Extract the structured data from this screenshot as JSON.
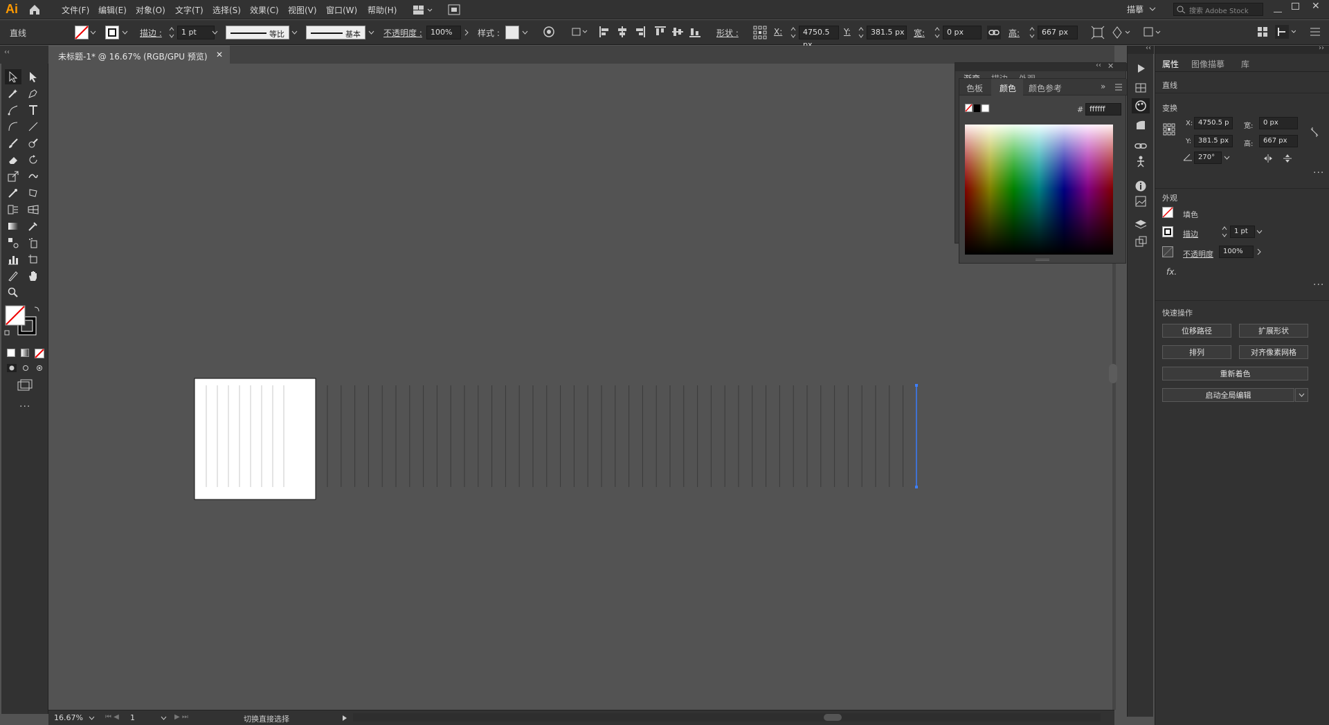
{
  "app": {
    "logo": "Ai"
  },
  "menu": [
    "文件(F)",
    "编辑(E)",
    "对象(O)",
    "文字(T)",
    "选择(S)",
    "效果(C)",
    "视图(V)",
    "窗口(W)",
    "帮助(H)"
  ],
  "topright": {
    "workspace": "描摹",
    "search_placeholder": "搜索 Adobe Stock"
  },
  "control": {
    "selection_label": "直线",
    "stroke_label": "描边 :",
    "stroke_value": "1 pt",
    "profile1": "等比",
    "profile2": "基本",
    "opacity_label": "不透明度 :",
    "opacity_value": "100%",
    "style_label": "样式 :",
    "shape_label": "形状 :",
    "x_label": "X:",
    "x_value": "4750.5 px",
    "y_label": "Y:",
    "y_value": "381.5 px",
    "w_label": "宽:",
    "w_value": "0 px",
    "h_label": "高:",
    "h_value": "667 px"
  },
  "doc_tab": {
    "title": "未标题-1* @ 16.67% (RGB/GPU 预览)"
  },
  "status": {
    "zoom": "16.67%",
    "page": "1",
    "hint": "切换直接选择"
  },
  "color_panel": {
    "back_tabs": [
      "渐变",
      "描边",
      "外观"
    ],
    "tabs": [
      "色板",
      "颜色",
      "颜色参考"
    ],
    "hex_label": "#",
    "hex_value": "ffffff"
  },
  "properties": {
    "tabs": [
      "属性",
      "图像描摹",
      "库"
    ],
    "object_type": "直线",
    "transform_title": "变换",
    "x_label": "X:",
    "x_value": "4750.5 p",
    "y_label": "Y:",
    "y_value": "381.5 px",
    "w_label": "宽:",
    "w_value": "0 px",
    "h_label": "高:",
    "h_value": "667 px",
    "angle_value": "270°",
    "appearance_title": "外观",
    "fill_label": "填色",
    "stroke_label": "描边",
    "stroke_value": "1 pt",
    "opacity_label": "不透明度",
    "opacity_value": "100%",
    "fx_label": "fx.",
    "quick_title": "快速操作",
    "btn_offset": "位移路径",
    "btn_expand": "扩展形状",
    "btn_arrange": "排列",
    "btn_pixel": "对齐像素网格",
    "btn_recolor": "重新着色",
    "btn_global": "启动全局编辑"
  },
  "colors": {
    "accent": "#3d7fff",
    "logo": "#ff9a00",
    "bg": "#535353"
  }
}
